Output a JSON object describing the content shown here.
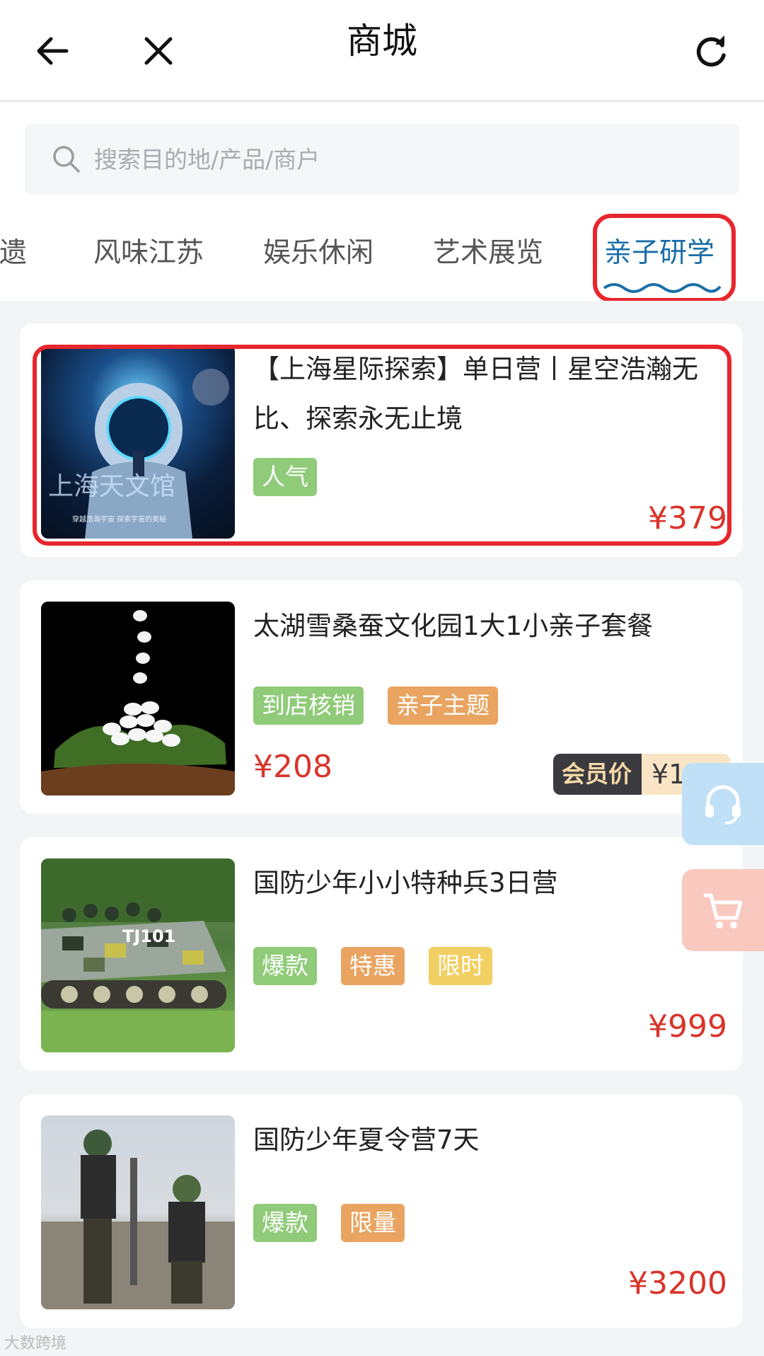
{
  "header": {
    "title": "商城",
    "back_icon": "arrow-left-icon",
    "close_icon": "close-icon",
    "refresh_icon": "refresh-icon"
  },
  "search": {
    "placeholder": "搜索目的地/产品/商户",
    "icon": "search-icon"
  },
  "tabs": [
    {
      "label": "非遗"
    },
    {
      "label": "风味江苏"
    },
    {
      "label": "娱乐休闲"
    },
    {
      "label": "艺术展览"
    },
    {
      "label": "亲子研学",
      "active": true
    }
  ],
  "products": [
    {
      "name": "【上海星际探索】单日营丨星空浩瀚无比、探索永无止境",
      "tags": [
        "人气"
      ],
      "price": "¥379",
      "thumb_text": "上海天文馆",
      "thumb_caption": "穿越浩瀚宇宙    探索宇宙的奥秘"
    },
    {
      "name": "太湖雪桑蚕文化园1大1小亲子套餐",
      "tags": [
        "到店核销",
        "亲子主题"
      ],
      "price": "¥208",
      "member_label": "会员价",
      "member_price": "¥118"
    },
    {
      "name": "国防少年小小特种兵3日营",
      "tags": [
        "爆款",
        "特惠",
        "限时"
      ],
      "price": "¥999",
      "thumb_text": "TJ101"
    },
    {
      "name": "国防少年夏令营7天",
      "tags": [
        "爆款",
        "限量"
      ],
      "price": "¥3200"
    }
  ],
  "floating": {
    "customer_service_icon": "headset-icon",
    "cart_icon": "cart-icon"
  },
  "watermark": "大数跨境",
  "colors": {
    "accent_red": "#e8262d",
    "price_red": "#d9342b",
    "active_tab": "#1a6ea8"
  }
}
